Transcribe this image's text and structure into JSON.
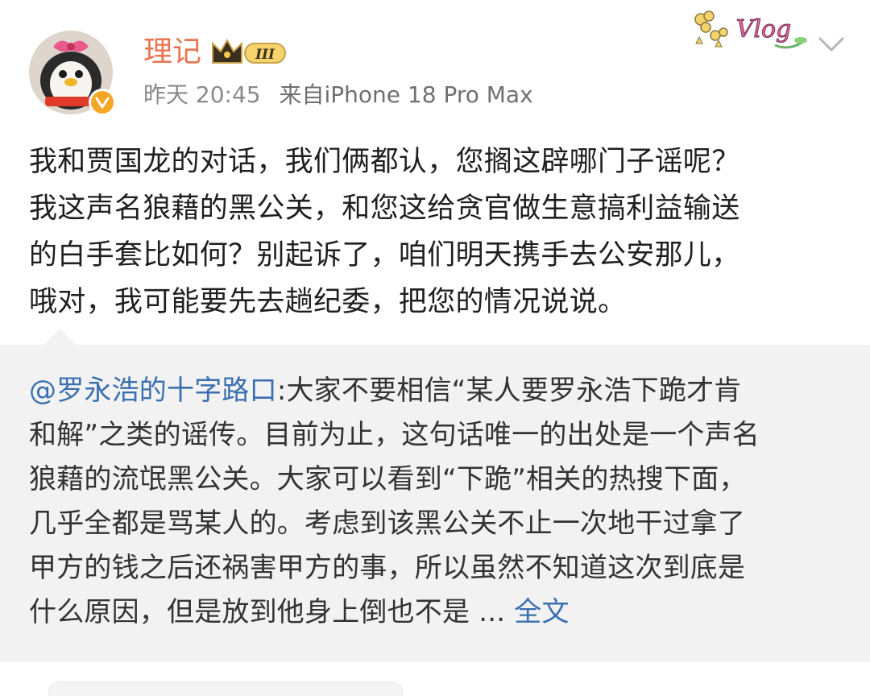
{
  "post": {
    "username": "理记",
    "level_badge": "III",
    "time": "昨天 20:45",
    "source": "来自iPhone 18 Pro Max",
    "sticker_text": "Vlog",
    "text_lines": [
      "我和贾国龙的对话，我们俩都认，您搁这辟哪门子谣呢？",
      "我这声名狼藉的黑公关，和您这给贪官做生意搞利益输送",
      "的白手套比如何？别起诉了，咱们明天携手去公安那儿，",
      "哦对，我可能要先去趟纪委，把您的情况说说。"
    ]
  },
  "repost": {
    "mention": "@罗永浩的十字路口",
    "first_line_rest": ":大家不要相信“某人要罗永浩下跪才肯",
    "lines": [
      "和解”之类的谣传。目前为止，这句话唯一的出处是一个声名",
      "狼藉的流氓黑公关。大家可以看到“下跪”相关的热搜下面，",
      "几乎全都是骂某人的。考虑到该黑公关不止一次地干过拿了",
      "甲方的钱之后还祸害甲方的事，所以虽然不知道这次到底是"
    ],
    "last_line": "什么原因，但是放到他身上倒也不是 ...",
    "full_text_link": "全文"
  },
  "icons": {
    "avatar": "penguin-avatar",
    "verified": "verified-v-icon",
    "level": "crown-level-icon",
    "more": "chevron-down-icon"
  },
  "colors": {
    "username": "#eb7350",
    "link": "#3a6fb0",
    "repost_bg": "#f2f2f2"
  }
}
